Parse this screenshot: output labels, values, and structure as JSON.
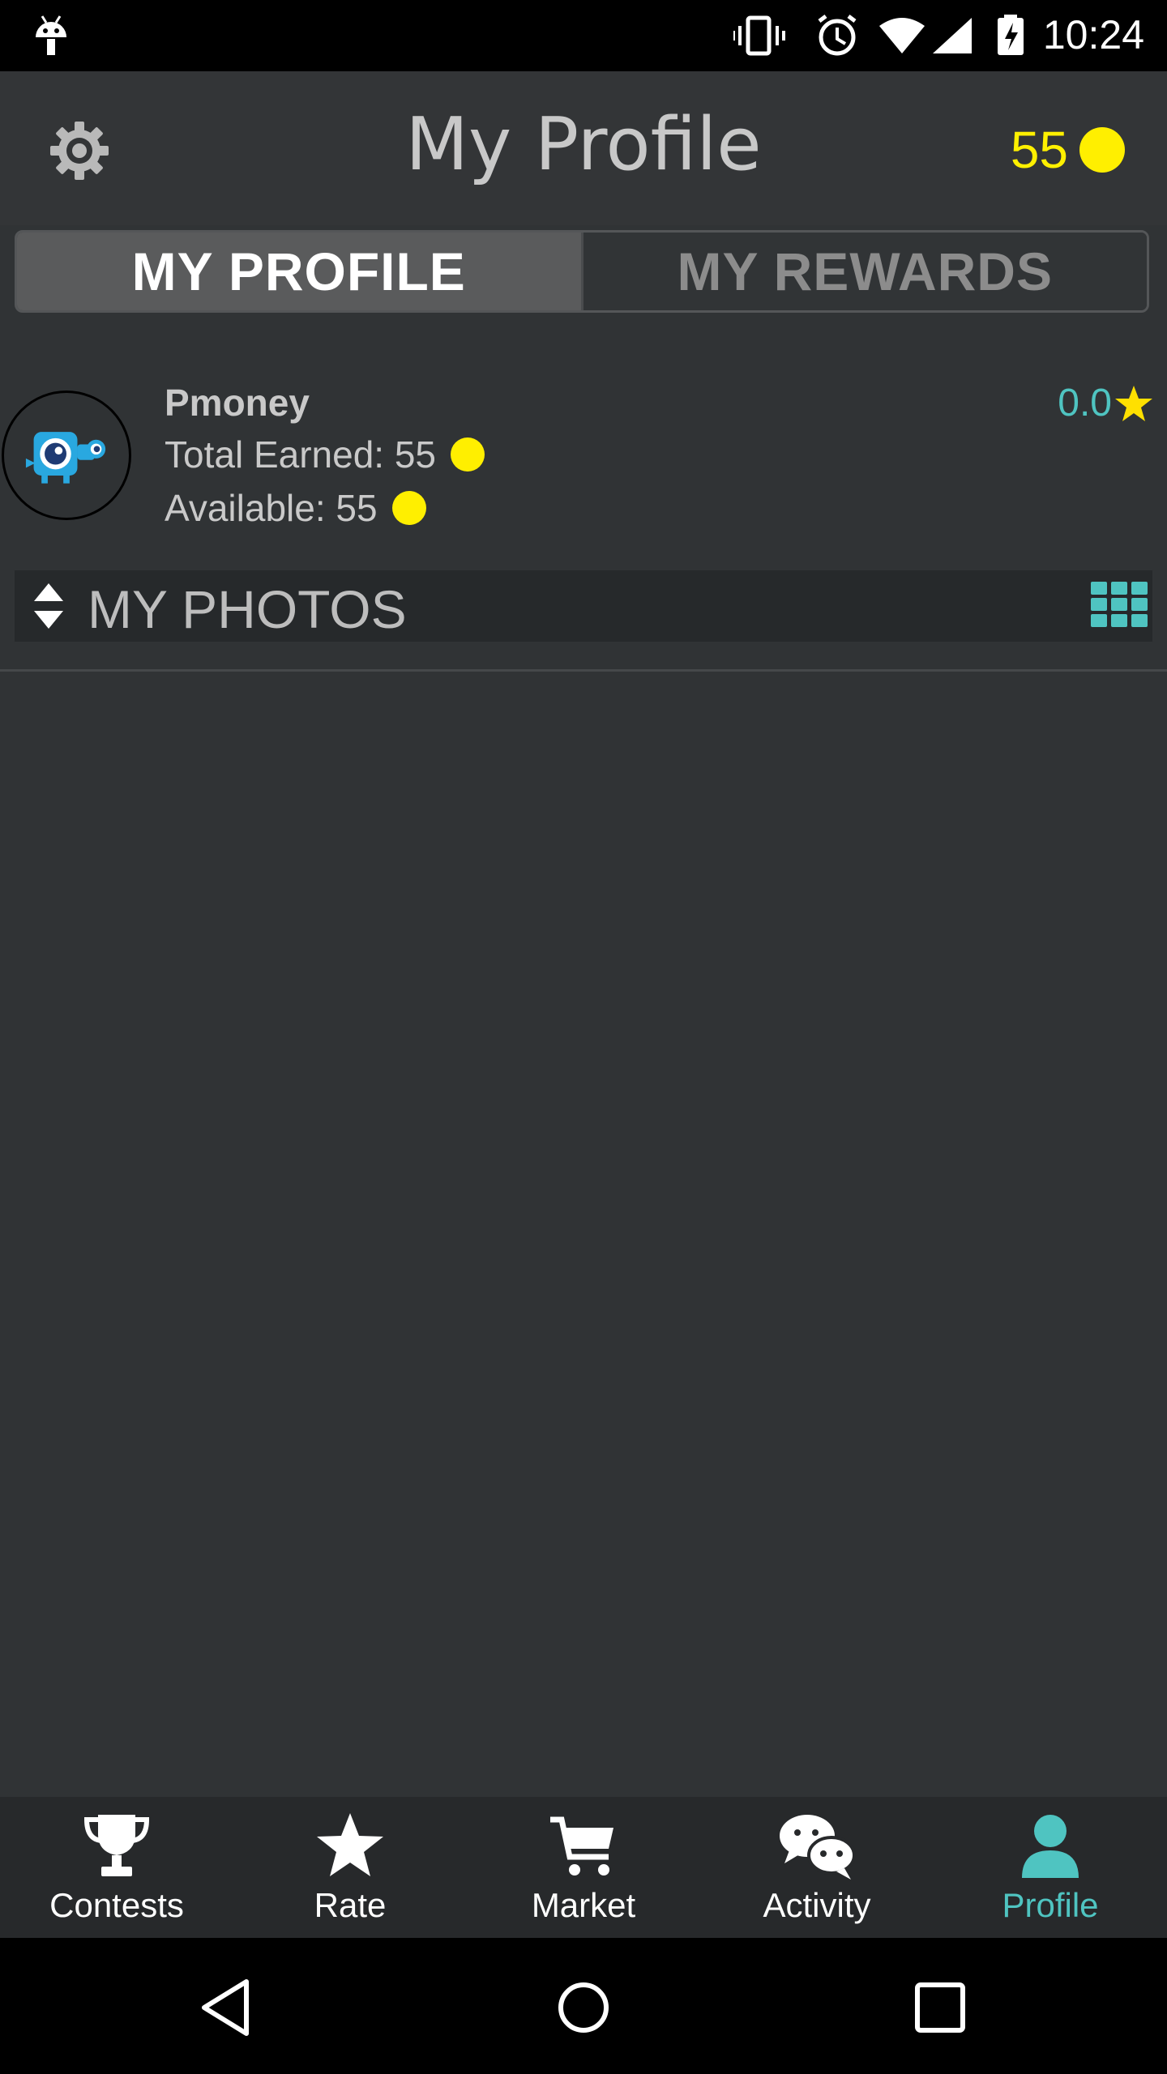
{
  "status_bar": {
    "time": "10:24"
  },
  "toolbar": {
    "title": "My Profile",
    "coin_count": "55"
  },
  "tabs": [
    {
      "label": "MY PROFILE",
      "active": true
    },
    {
      "label": "MY REWARDS",
      "active": false
    }
  ],
  "profile": {
    "username": "Pmoney",
    "total_earned": "Total Earned: 55",
    "available": "Available: 55",
    "rating": "0.0"
  },
  "photos_section": {
    "title": "MY PHOTOS"
  },
  "bottom_nav": [
    {
      "label": "Contests",
      "icon": "trophy-icon"
    },
    {
      "label": "Rate",
      "icon": "star-icon"
    },
    {
      "label": "Market",
      "icon": "cart-icon"
    },
    {
      "label": "Activity",
      "icon": "chat-icon"
    },
    {
      "label": "Profile",
      "icon": "person-icon",
      "active": true
    }
  ],
  "colors": {
    "accent": "#4fc4c1",
    "coin": "#ffef00",
    "background": "#303335"
  }
}
